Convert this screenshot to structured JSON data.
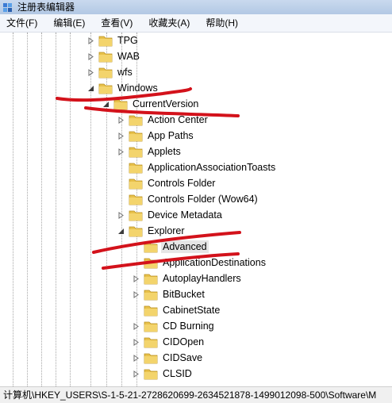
{
  "window": {
    "title": "注册表编辑器"
  },
  "menu": [
    {
      "label": "文件(F)"
    },
    {
      "label": "编辑(E)"
    },
    {
      "label": "查看(V)"
    },
    {
      "label": "收藏夹(A)"
    },
    {
      "label": "帮助(H)"
    }
  ],
  "tree": [
    {
      "label": "TPG",
      "level": 0,
      "state": "collapsed"
    },
    {
      "label": "WAB",
      "level": 0,
      "state": "collapsed"
    },
    {
      "label": "wfs",
      "level": 0,
      "state": "collapsed"
    },
    {
      "label": "Windows",
      "level": 0,
      "state": "expanded"
    },
    {
      "label": "CurrentVersion",
      "level": 1,
      "state": "expanded"
    },
    {
      "label": "Action Center",
      "level": 2,
      "state": "collapsed"
    },
    {
      "label": "App Paths",
      "level": 2,
      "state": "collapsed"
    },
    {
      "label": "Applets",
      "level": 2,
      "state": "collapsed"
    },
    {
      "label": "ApplicationAssociationToasts",
      "level": 2,
      "state": "leaf"
    },
    {
      "label": "Controls Folder",
      "level": 2,
      "state": "leaf"
    },
    {
      "label": "Controls Folder (Wow64)",
      "level": 2,
      "state": "leaf"
    },
    {
      "label": "Device Metadata",
      "level": 2,
      "state": "collapsed"
    },
    {
      "label": "Explorer",
      "level": 2,
      "state": "expanded"
    },
    {
      "label": "Advanced",
      "level": 3,
      "state": "leaf",
      "selected": true
    },
    {
      "label": "ApplicationDestinations",
      "level": 3,
      "state": "leaf"
    },
    {
      "label": "AutoplayHandlers",
      "level": 3,
      "state": "collapsed"
    },
    {
      "label": "BitBucket",
      "level": 3,
      "state": "collapsed"
    },
    {
      "label": "CabinetState",
      "level": 3,
      "state": "leaf"
    },
    {
      "label": "CD Burning",
      "level": 3,
      "state": "collapsed"
    },
    {
      "label": "CIDOpen",
      "level": 3,
      "state": "collapsed"
    },
    {
      "label": "CIDSave",
      "level": 3,
      "state": "collapsed"
    },
    {
      "label": "CLSID",
      "level": 3,
      "state": "collapsed"
    }
  ],
  "status": {
    "path": "计算机\\HKEY_USERS\\S-1-5-21-2728620699-2634521878-1499012098-500\\Software\\M"
  },
  "colors": {
    "folder": "#e8c14b",
    "annotation": "#d3121b",
    "selection": "#e6e6e6"
  }
}
